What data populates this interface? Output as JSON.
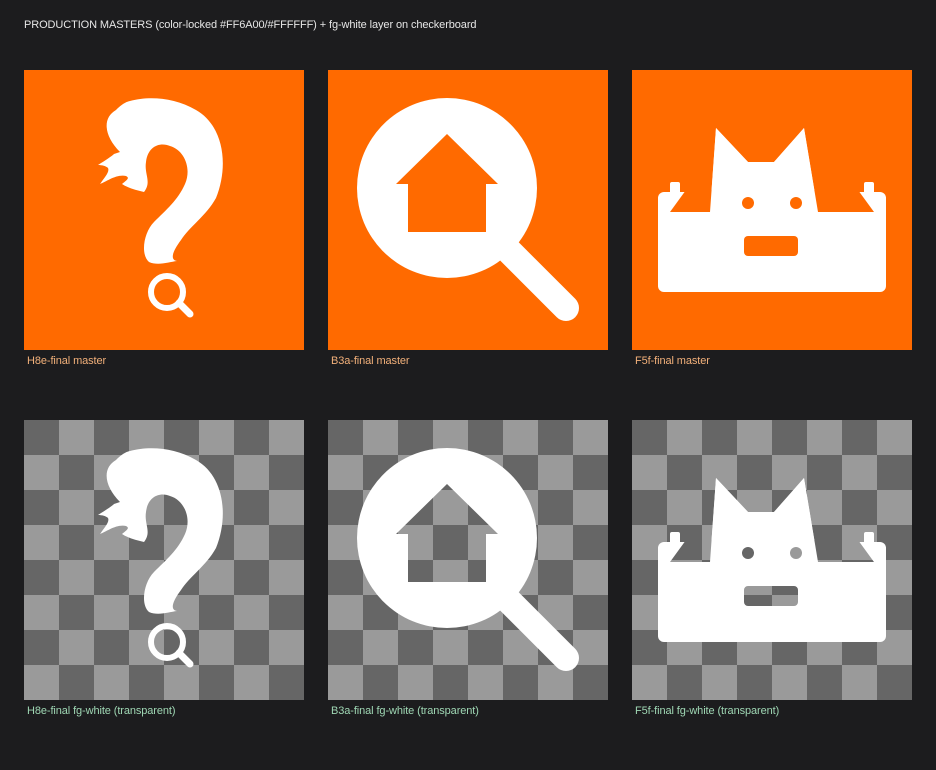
{
  "header": {
    "title": "PRODUCTION MASTERS (color-locked #FF6A00/#FFFFFF) + fg-white layer on checkerboard"
  },
  "colors": {
    "brand_orange": "#FF6A00",
    "foreground": "#FFFFFF",
    "page_background": "#1C1C1E",
    "checker_light": "#9A9A9A",
    "checker_dark": "#666666"
  },
  "masters": [
    {
      "icon": "question-mark-tail-with-magnifier-icon",
      "caption": "H8e-final master"
    },
    {
      "icon": "magnifier-with-house-icon",
      "caption": "B3a-final master"
    },
    {
      "icon": "cat-in-box-icon",
      "caption": "F5f-final master"
    }
  ],
  "transparent_layers": [
    {
      "icon": "question-mark-tail-with-magnifier-icon",
      "caption": "H8e-final fg-white (transparent)"
    },
    {
      "icon": "magnifier-with-house-icon",
      "caption": "B3a-final fg-white (transparent)"
    },
    {
      "icon": "cat-in-box-icon",
      "caption": "F5f-final fg-white (transparent)"
    }
  ]
}
